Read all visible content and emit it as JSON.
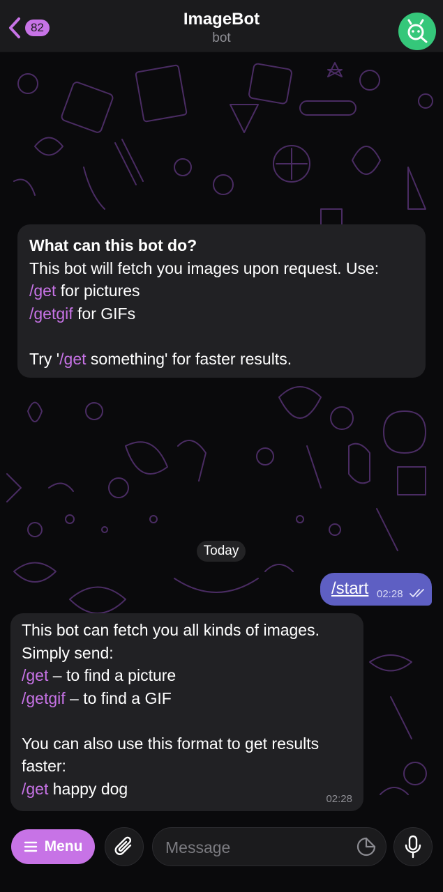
{
  "header": {
    "back_count": "82",
    "title": "ImageBot",
    "subtitle": "bot"
  },
  "intro": {
    "heading": "What can this bot do?",
    "line1": "This bot will fetch you images upon request. Use:",
    "get_cmd": "/get",
    "get_desc": " for pictures",
    "getgif_cmd": "/getgif",
    "getgif_desc": " for GIFs",
    "try_prefix": "Try '",
    "try_cmd": "/get",
    "try_suffix": " something' for faster results."
  },
  "date_separator": "Today",
  "outgoing": {
    "text": "/start",
    "time": "02:28"
  },
  "reply": {
    "line1": "This bot can fetch you all kinds of images.",
    "line2": "Simply send:",
    "get_cmd": "/get",
    "get_desc": " – to find a picture",
    "getgif_cmd": "/getgif",
    "getgif_desc": " – to find a GIF",
    "line5": "You can also use this format to get results",
    "line6": "faster:",
    "example_cmd": "/get",
    "example_desc": " happy dog",
    "time": "02:28"
  },
  "input_bar": {
    "menu_label": "Menu",
    "placeholder": "Message"
  },
  "colors": {
    "accent": "#c773e6",
    "outgoing_bubble": "#5e5fc3",
    "avatar": "#35c77a",
    "bubble": "#212124"
  },
  "icons": [
    "back-chevron-icon",
    "bot-avatar-icon",
    "menu-lines-icon",
    "paperclip-icon",
    "sticker-icon",
    "microphone-icon",
    "read-double-check-icon"
  ]
}
